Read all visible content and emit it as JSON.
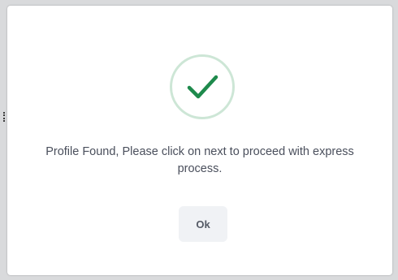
{
  "dialog": {
    "icon": "checkmark-icon",
    "message": "Profile Found, Please click on next to proceed with express process.",
    "ok_label": "Ok"
  },
  "colors": {
    "check_stroke": "#1e8a4c",
    "circle_border": "#cde6d6",
    "message_text": "#4a4f5c",
    "button_bg": "#f0f2f5",
    "button_text": "#555b66"
  }
}
